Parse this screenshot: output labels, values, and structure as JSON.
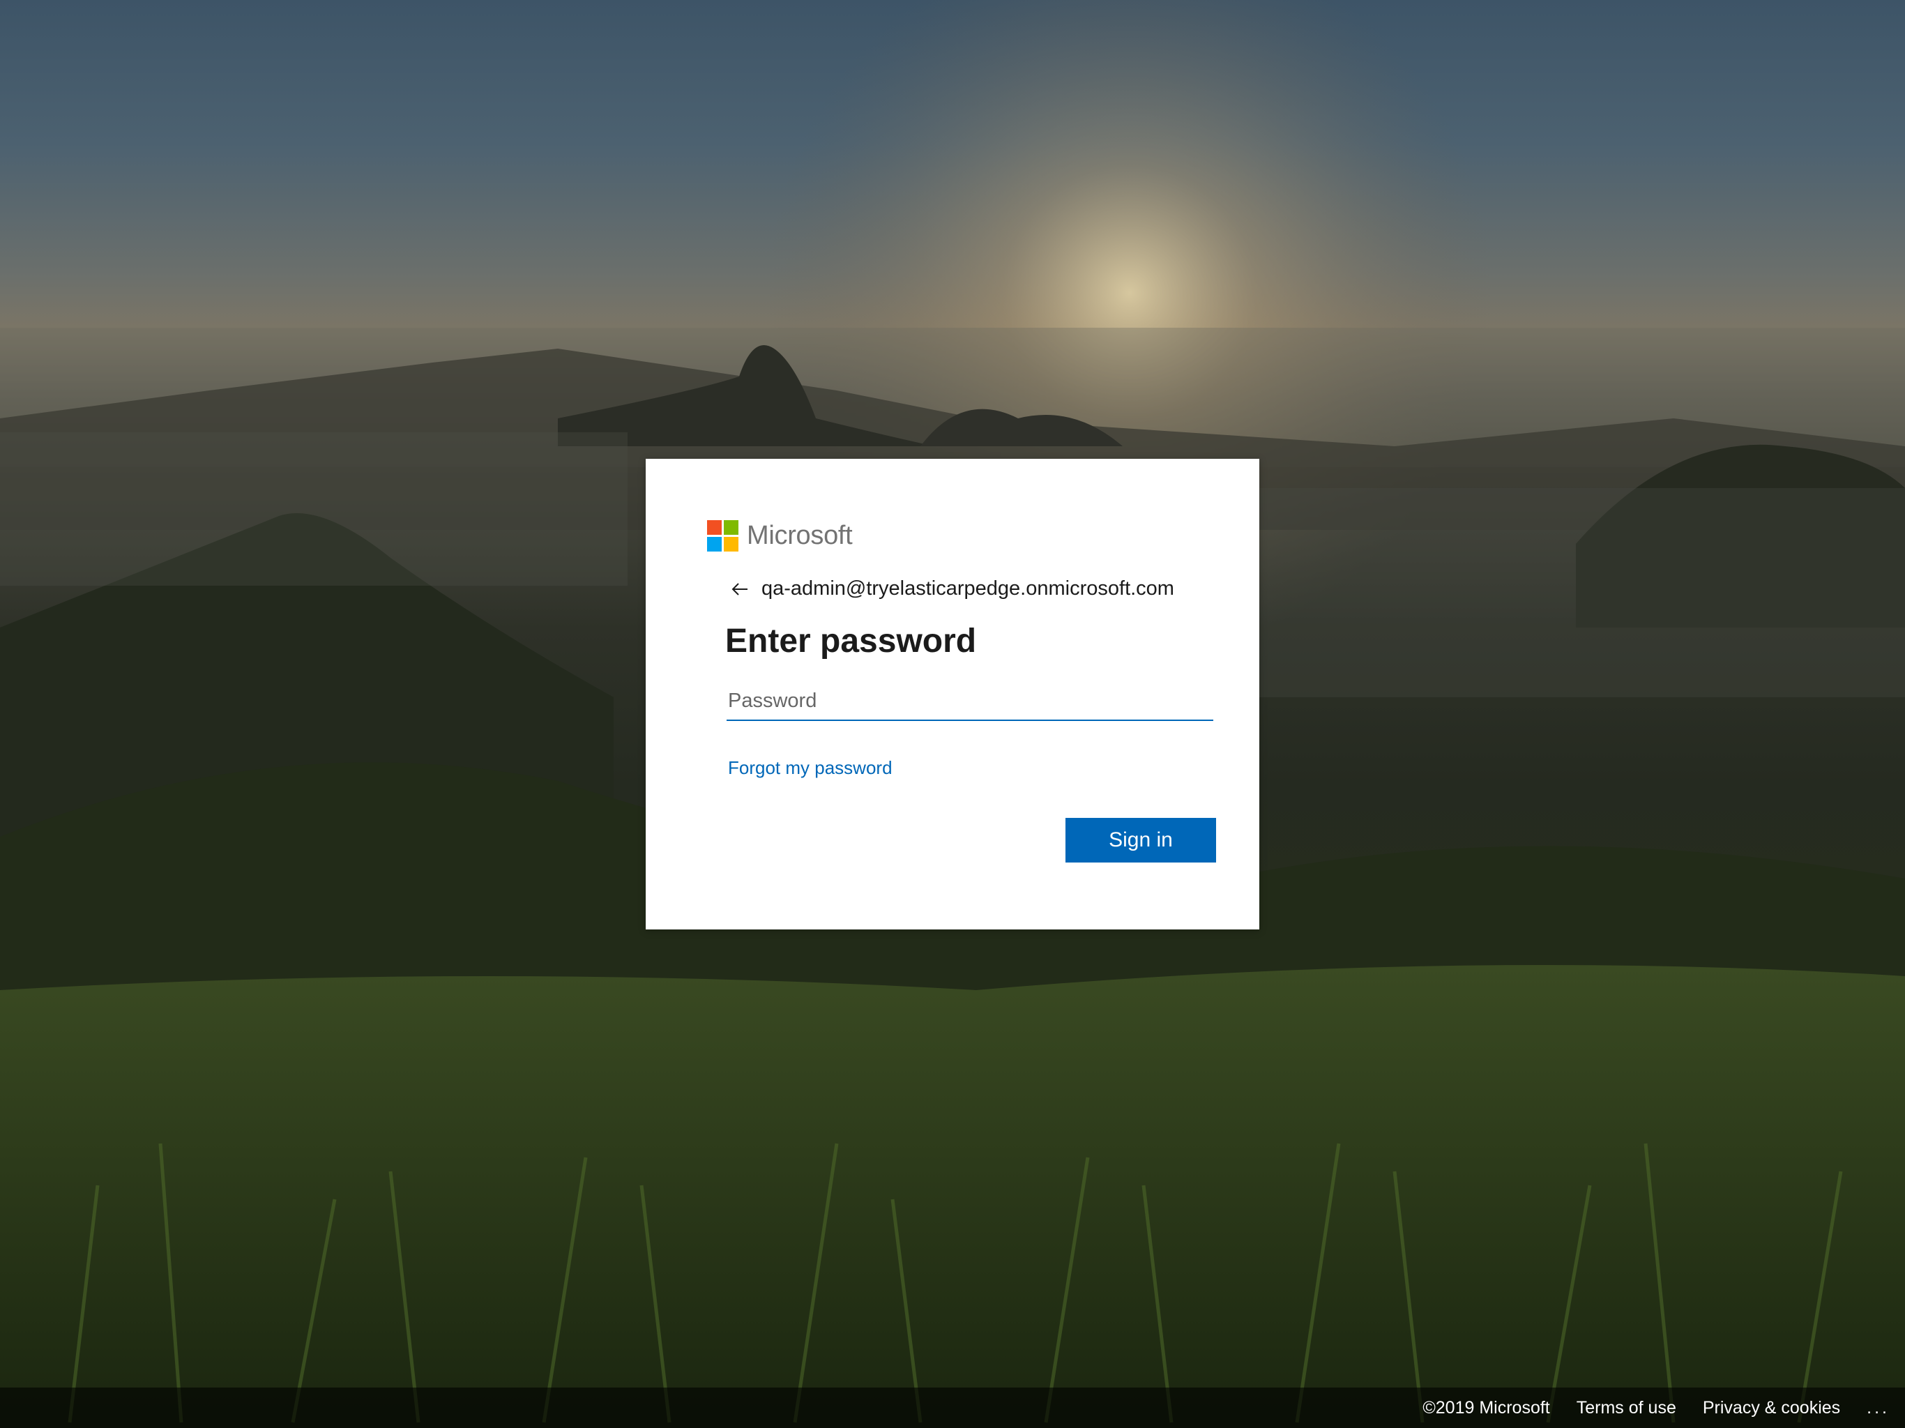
{
  "brand": {
    "name": "Microsoft",
    "logo_colors": [
      "#f25022",
      "#7fba00",
      "#00a4ef",
      "#ffb900"
    ]
  },
  "signin": {
    "identity_email": "qa-admin@tryelasticarpedge.onmicrosoft.com",
    "title": "Enter password",
    "password_placeholder": "Password",
    "password_value": "",
    "forgot_link": "Forgot my password",
    "submit_label": "Sign in",
    "accent_color": "#0067b8"
  },
  "footer": {
    "copyright": "©2019 Microsoft",
    "terms": "Terms of use",
    "privacy": "Privacy & cookies",
    "more": "..."
  },
  "icons": {
    "back": "arrow-left-icon",
    "more": "ellipsis-icon"
  }
}
